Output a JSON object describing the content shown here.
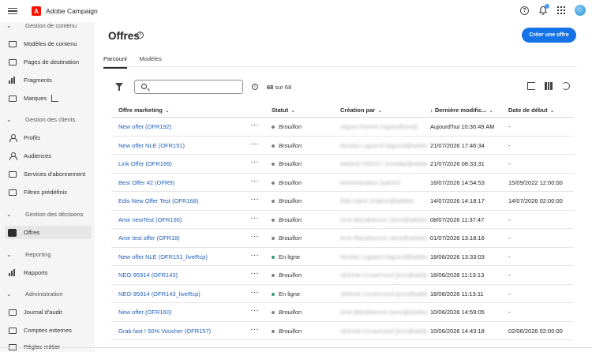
{
  "app": {
    "title": "Adobe Campaign",
    "logo_letter": "A"
  },
  "sidebar": {
    "sections": [
      {
        "label": "Gestion de contenu",
        "items": [
          {
            "label": "Modèles de contenu",
            "icon": "template-icon"
          },
          {
            "label": "Pages de destination",
            "icon": "page-icon"
          },
          {
            "label": "Fragments",
            "icon": "fragment-icon"
          },
          {
            "label": "Marques",
            "icon": "brand-icon",
            "external": true
          }
        ]
      },
      {
        "label": "Gestion des clients",
        "items": [
          {
            "label": "Profils",
            "icon": "profile-icon"
          },
          {
            "label": "Audiences",
            "icon": "audience-icon"
          },
          {
            "label": "Services d'abonnement",
            "icon": "subscription-icon"
          },
          {
            "label": "Filtres prédéfinis",
            "icon": "filter-icon"
          }
        ]
      },
      {
        "label": "Gestion des décisions",
        "items": [
          {
            "label": "Offres",
            "icon": "offer-icon",
            "active": true
          }
        ]
      },
      {
        "label": "Reporting",
        "items": [
          {
            "label": "Rapports",
            "icon": "chart-icon"
          }
        ]
      },
      {
        "label": "Administration",
        "items": [
          {
            "label": "Journal d'audit",
            "icon": "audit-icon"
          },
          {
            "label": "Comptes externes",
            "icon": "account-icon"
          },
          {
            "label": "Règles métier",
            "icon": "rules-icon"
          }
        ]
      }
    ]
  },
  "page": {
    "title": "Offres",
    "create_button": "Créer une offre",
    "tabs": [
      "Parcourir",
      "Modèles"
    ],
    "count_value": "68",
    "count_text": " sur 68"
  },
  "table": {
    "headers": [
      "Offre marketing",
      "Statut",
      "Création par",
      "Dernière modific...",
      "Date de début"
    ],
    "rows": [
      {
        "name": "New offer (OFR192)",
        "status": "Brouillon",
        "creator": "Vignes Florent (vignesflorent)",
        "modified": "Aujourd'hui 10:36:49 AM",
        "start": "-"
      },
      {
        "name": "New offer NLE (OFR151)",
        "status": "Brouillon",
        "creator": "Nicolas Lagrand (lagrand@adobe)",
        "modified": "21/07/2026 17:46:34",
        "start": "-"
      },
      {
        "name": "Link Offer (OFR189)",
        "status": "Brouillon",
        "creator": "Mahesh REDDY (mreddy@adobe)",
        "modified": "21/07/2026 08:33:31",
        "start": "-"
      },
      {
        "name": "Best Offer #2 (OFR9)",
        "status": "Brouillon",
        "creator": "Administrateur (admin)",
        "modified": "16/07/2026 14:54:53",
        "start": "15/09/2022 12:00:00"
      },
      {
        "name": "Edis New Offer Test (OFR168)",
        "status": "Brouillon",
        "creator": "Edis Djeric (edjeric@adobe)",
        "modified": "14/07/2026 14:18:17",
        "start": "14/07/2026 02:00:00"
      },
      {
        "name": "Amir newTest (OFR165)",
        "status": "Brouillon",
        "creator": "Amir Bejrakiarevic (amir@adobe)",
        "modified": "08/07/2026 11:37:47",
        "start": "-"
      },
      {
        "name": "Amir test offer (OFR18)",
        "status": "Brouillon",
        "creator": "Amir Bejrakiarevic (amir@adobe)",
        "modified": "01/07/2026 13:18:16",
        "start": "-"
      },
      {
        "name": "New offer NLE (OFR151_liveRcp)",
        "status": "En ligne",
        "creator": "Nicolas Lagrand (lagrand@adobe)",
        "modified": "18/06/2026 13:33:03",
        "start": "-"
      },
      {
        "name": "NEO-95914 (OFR143)",
        "status": "Brouillon",
        "creator": "Jérémie Conarmond (jcon@adobe)",
        "modified": "18/06/2026 11:13:13",
        "start": "-"
      },
      {
        "name": "NEO-95914 (OFR143_liveRcp)",
        "status": "En ligne",
        "creator": "Jérémie Conarmond (jcon@adobe)",
        "modified": "18/06/2026 11:13:11",
        "start": "-"
      },
      {
        "name": "New offer (OFR160)",
        "status": "Brouillon",
        "creator": "Amir Bejrakiarevic (amir@adobe)",
        "modified": "10/06/2026 14:59:05",
        "start": "-"
      },
      {
        "name": "Grab fast ! 50% Voucher (OFR157)",
        "status": "Brouillon",
        "creator": "Jérémie Conarmond (jcon@adobe)",
        "modified": "10/06/2026 14:43:18",
        "start": "02/06/2026 02:00:00"
      }
    ]
  },
  "colors": {
    "accent": "#1473e6",
    "link": "#1f5fb8",
    "draft": "#808080",
    "live": "#2d9d78"
  }
}
